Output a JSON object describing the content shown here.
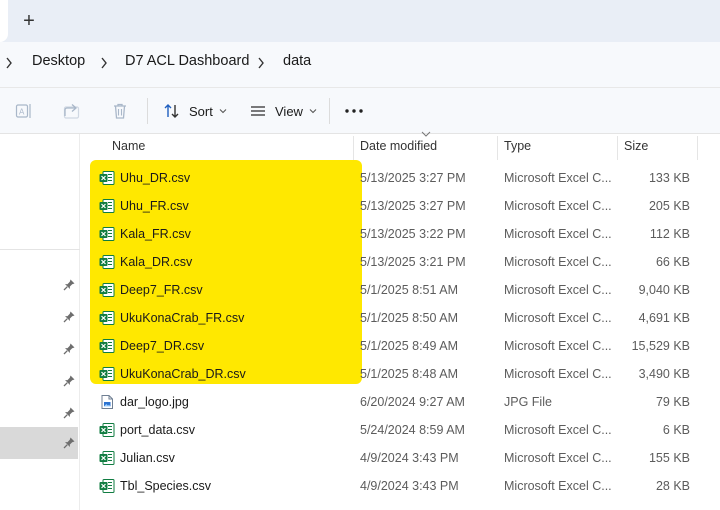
{
  "tabbar": {
    "new_tab_label": "+"
  },
  "breadcrumb": [
    {
      "label": "Desktop"
    },
    {
      "label": "D7 ACL Dashboard"
    },
    {
      "label": "data"
    }
  ],
  "toolbar": {
    "sort_label": "Sort",
    "view_label": "View",
    "more_label": "•••"
  },
  "columns": {
    "name": "Name",
    "date_modified": "Date modified",
    "type": "Type",
    "size": "Size"
  },
  "files": [
    {
      "name": "Uhu_DR.csv",
      "date": "5/13/2025 3:27 PM",
      "type": "Microsoft Excel C...",
      "size": "133 KB",
      "icon": "excel-csv-icon"
    },
    {
      "name": "Uhu_FR.csv",
      "date": "5/13/2025 3:27 PM",
      "type": "Microsoft Excel C...",
      "size": "205 KB",
      "icon": "excel-csv-icon"
    },
    {
      "name": "Kala_FR.csv",
      "date": "5/13/2025 3:22 PM",
      "type": "Microsoft Excel C...",
      "size": "112 KB",
      "icon": "excel-csv-icon"
    },
    {
      "name": "Kala_DR.csv",
      "date": "5/13/2025 3:21 PM",
      "type": "Microsoft Excel C...",
      "size": "66 KB",
      "icon": "excel-csv-icon"
    },
    {
      "name": "Deep7_FR.csv",
      "date": "5/1/2025 8:51 AM",
      "type": "Microsoft Excel C...",
      "size": "9,040 KB",
      "icon": "excel-csv-icon"
    },
    {
      "name": "UkuKonaCrab_FR.csv",
      "date": "5/1/2025 8:50 AM",
      "type": "Microsoft Excel C...",
      "size": "4,691 KB",
      "icon": "excel-csv-icon"
    },
    {
      "name": "Deep7_DR.csv",
      "date": "5/1/2025 8:49 AM",
      "type": "Microsoft Excel C...",
      "size": "15,529 KB",
      "icon": "excel-csv-icon"
    },
    {
      "name": "UkuKonaCrab_DR.csv",
      "date": "5/1/2025 8:48 AM",
      "type": "Microsoft Excel C...",
      "size": "3,490 KB",
      "icon": "excel-csv-icon"
    },
    {
      "name": "dar_logo.jpg",
      "date": "6/20/2024 9:27 AM",
      "type": "JPG File",
      "size": "79 KB",
      "icon": "image-file-icon"
    },
    {
      "name": "port_data.csv",
      "date": "5/24/2024 8:59 AM",
      "type": "Microsoft Excel C...",
      "size": "6 KB",
      "icon": "excel-csv-icon"
    },
    {
      "name": "Julian.csv",
      "date": "4/9/2024 3:43 PM",
      "type": "Microsoft Excel C...",
      "size": "155 KB",
      "icon": "excel-csv-icon"
    },
    {
      "name": "Tbl_Species.csv",
      "date": "4/9/2024 3:43 PM",
      "type": "Microsoft Excel C...",
      "size": "28 KB",
      "icon": "excel-csv-icon"
    }
  ],
  "colors": {
    "highlight": "#ffe800",
    "excel_green": "#107c41",
    "nav_selected": "#d9d9d9"
  }
}
